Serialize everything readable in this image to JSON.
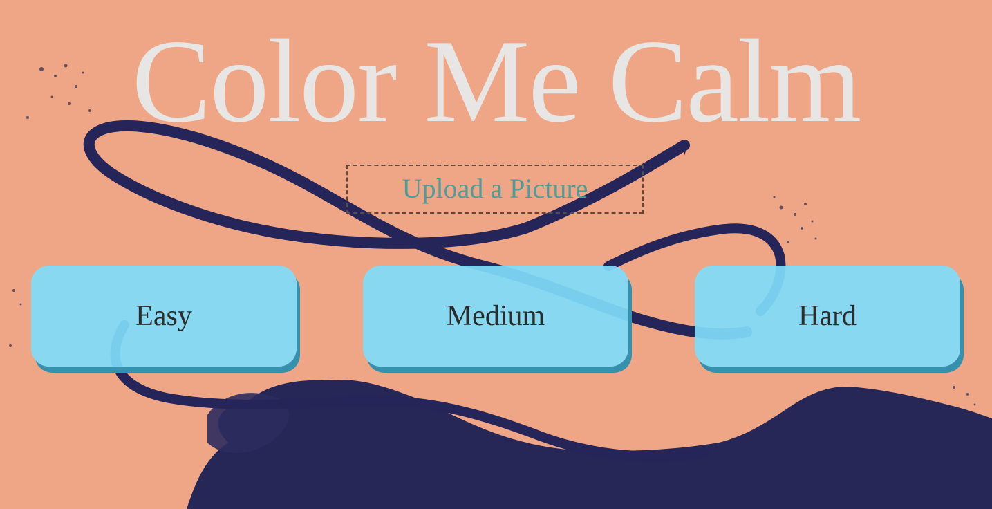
{
  "header": {
    "title": "Color Me Calm"
  },
  "upload": {
    "label": "Upload a Picture"
  },
  "difficulty": {
    "levels": [
      {
        "label": "Easy"
      },
      {
        "label": "Medium"
      },
      {
        "label": "Hard"
      }
    ]
  },
  "colors": {
    "background": "#efa686",
    "ink": "#262657",
    "title": "#e8e6e4",
    "upload_text": "#4f9c9c",
    "button": "#80dcfa",
    "button_shadow": "#3591ad"
  }
}
